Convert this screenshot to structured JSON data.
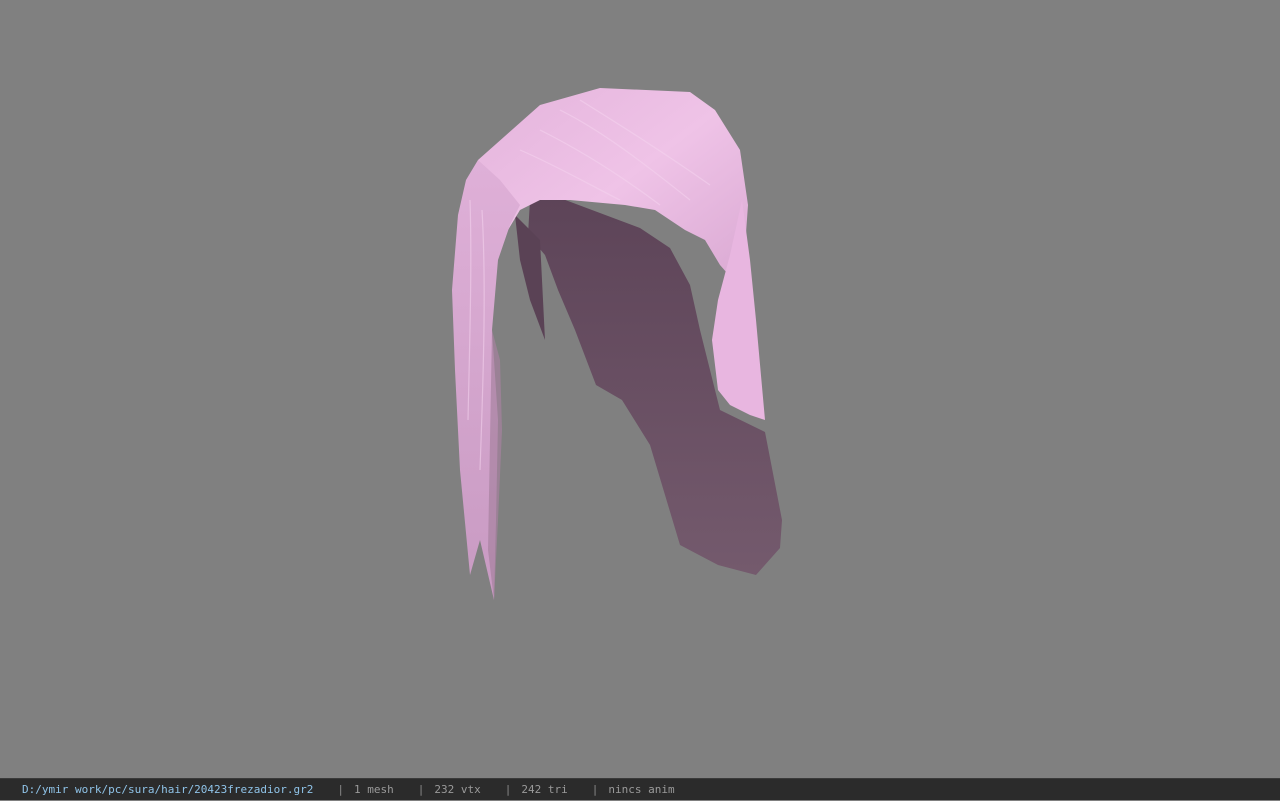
{
  "viewport": {
    "background": "#808080",
    "model": "pink-hair-mesh",
    "hair_color_light": "#e9b9e1",
    "hair_color_dark": "#6e4f66"
  },
  "status_bar": {
    "file_path": "D:/ymir work/pc/sura/hair/20423frezadior.gr2",
    "separator": "|",
    "mesh": "1 mesh",
    "vertices": "232 vtx",
    "triangles": "242 tri",
    "anim": "nincs anim"
  }
}
